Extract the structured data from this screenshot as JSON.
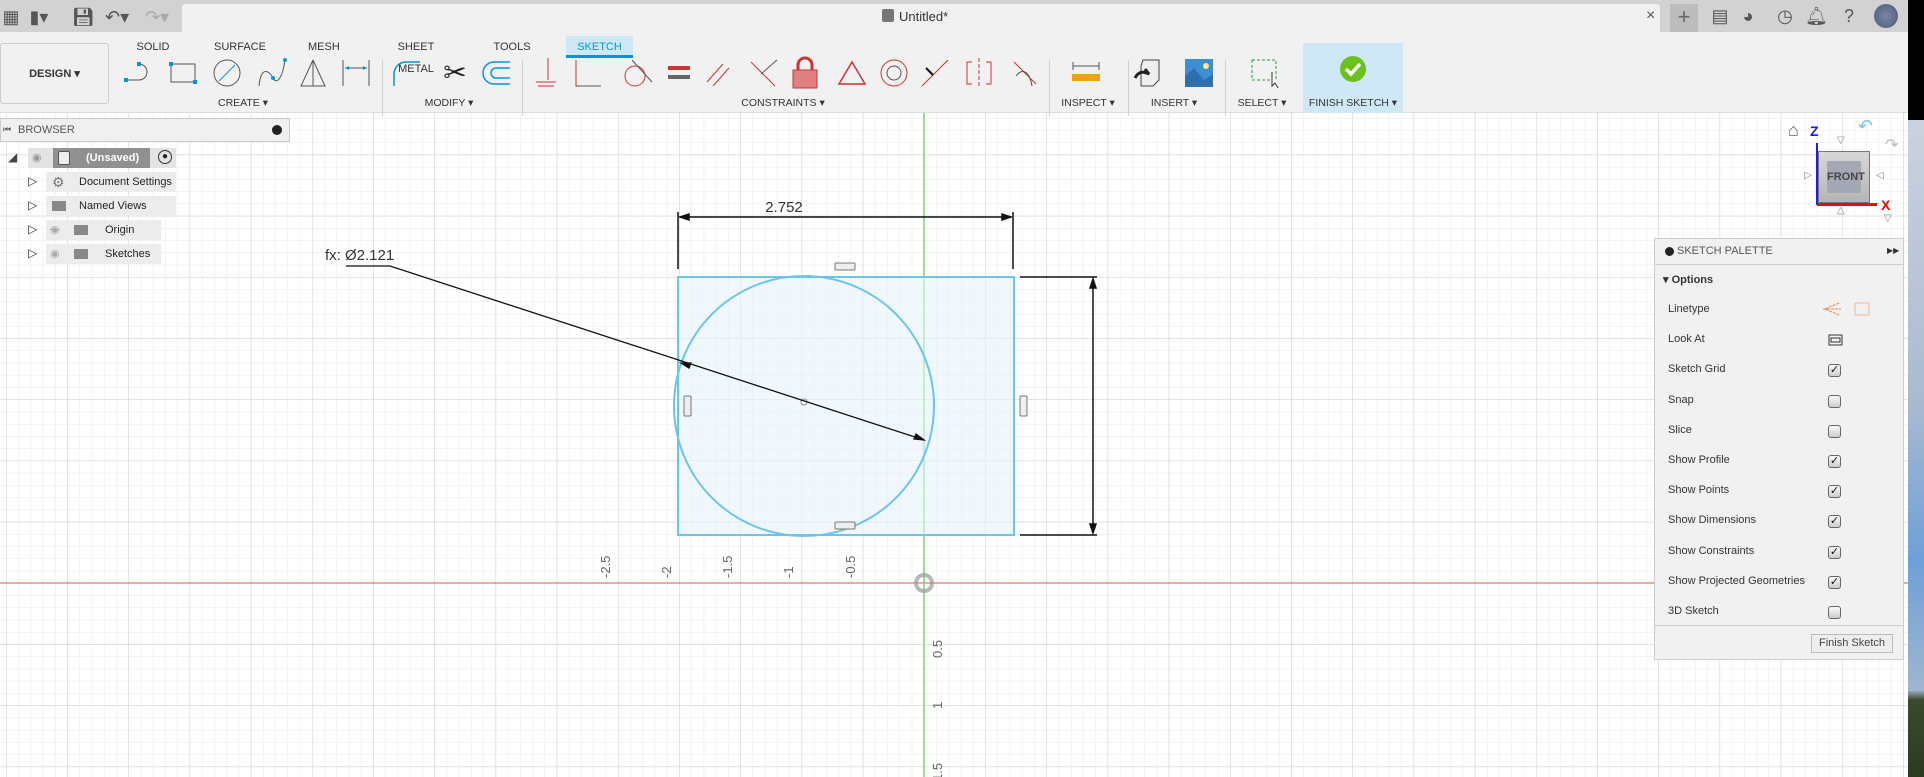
{
  "app": {
    "title": "Untitled*"
  },
  "toolbar": {
    "design_label": "DESIGN"
  },
  "tabs": [
    {
      "label": "SOLID"
    },
    {
      "label": "SURFACE"
    },
    {
      "label": "MESH"
    },
    {
      "label": "SHEET METAL"
    },
    {
      "label": "TOOLS"
    },
    {
      "label": "SKETCH",
      "active": true
    }
  ],
  "groups": {
    "create": "CREATE",
    "modify": "MODIFY",
    "constraints": "CONSTRAINTS",
    "inspect": "INSPECT",
    "insert": "INSERT",
    "select": "SELECT",
    "finish": "FINISH SKETCH"
  },
  "browser": {
    "title": "BROWSER",
    "root": "(Unsaved)",
    "items": [
      {
        "label": "Document Settings"
      },
      {
        "label": "Named Views"
      },
      {
        "label": "Origin",
        "visible": false
      },
      {
        "label": "Sketches",
        "visible": true
      }
    ]
  },
  "viewcube": {
    "face": "FRONT",
    "axis_z": "Z",
    "axis_x": "X"
  },
  "sketch": {
    "width_dim": "2.752",
    "diameter_dim": "fx: Ø2.121",
    "x_ticks": [
      "-2.5",
      "-2",
      "-1.5",
      "-1",
      "-0.5"
    ],
    "y_ticks": [
      "0.5",
      "1",
      "1.5"
    ]
  },
  "palette": {
    "title": "SKETCH PALETTE",
    "section": "Options",
    "rows": [
      {
        "label": "Linetype"
      },
      {
        "label": "Look At"
      },
      {
        "label": "Sketch Grid",
        "checked": true
      },
      {
        "label": "Snap",
        "checked": false
      },
      {
        "label": "Slice",
        "checked": false
      },
      {
        "label": "Show Profile",
        "checked": true
      },
      {
        "label": "Show Points",
        "checked": true
      },
      {
        "label": "Show Dimensions",
        "checked": true
      },
      {
        "label": "Show Constraints",
        "checked": true
      },
      {
        "label": "Show Projected Geometries",
        "checked": true
      },
      {
        "label": "3D Sketch",
        "checked": false
      }
    ],
    "finish_button": "Finish Sketch"
  },
  "colors": {
    "accent": "#0696d7",
    "profile": "#6cc4e8",
    "x_axis": "#d9534f",
    "y_axis": "#6fd66f",
    "finish": "#6cc21c"
  }
}
